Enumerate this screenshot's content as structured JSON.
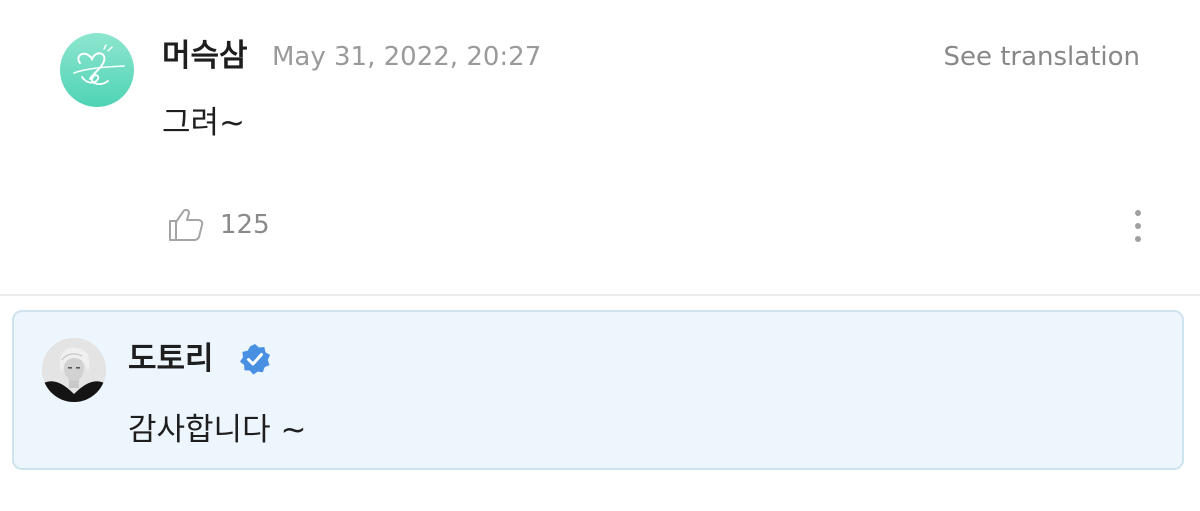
{
  "comment": {
    "username": "머슥삼",
    "timestamp": "May 31, 2022, 20:27",
    "translate_label": "See translation",
    "text": "그려~",
    "likes": "125",
    "icons": {
      "like": "thumbs-up-icon",
      "more": "more-vertical-icon"
    }
  },
  "reply": {
    "username": "도토리",
    "verified": true,
    "text": "감사합니다 ~",
    "icons": {
      "verified": "verified-badge-icon"
    }
  },
  "colors": {
    "avatar_main": "#5cd8bb",
    "reply_background": "#ecf6fc",
    "reply_border": "#cfe3ee",
    "verified_blue": "#4a90e2",
    "muted_text": "#9a9a9a"
  }
}
